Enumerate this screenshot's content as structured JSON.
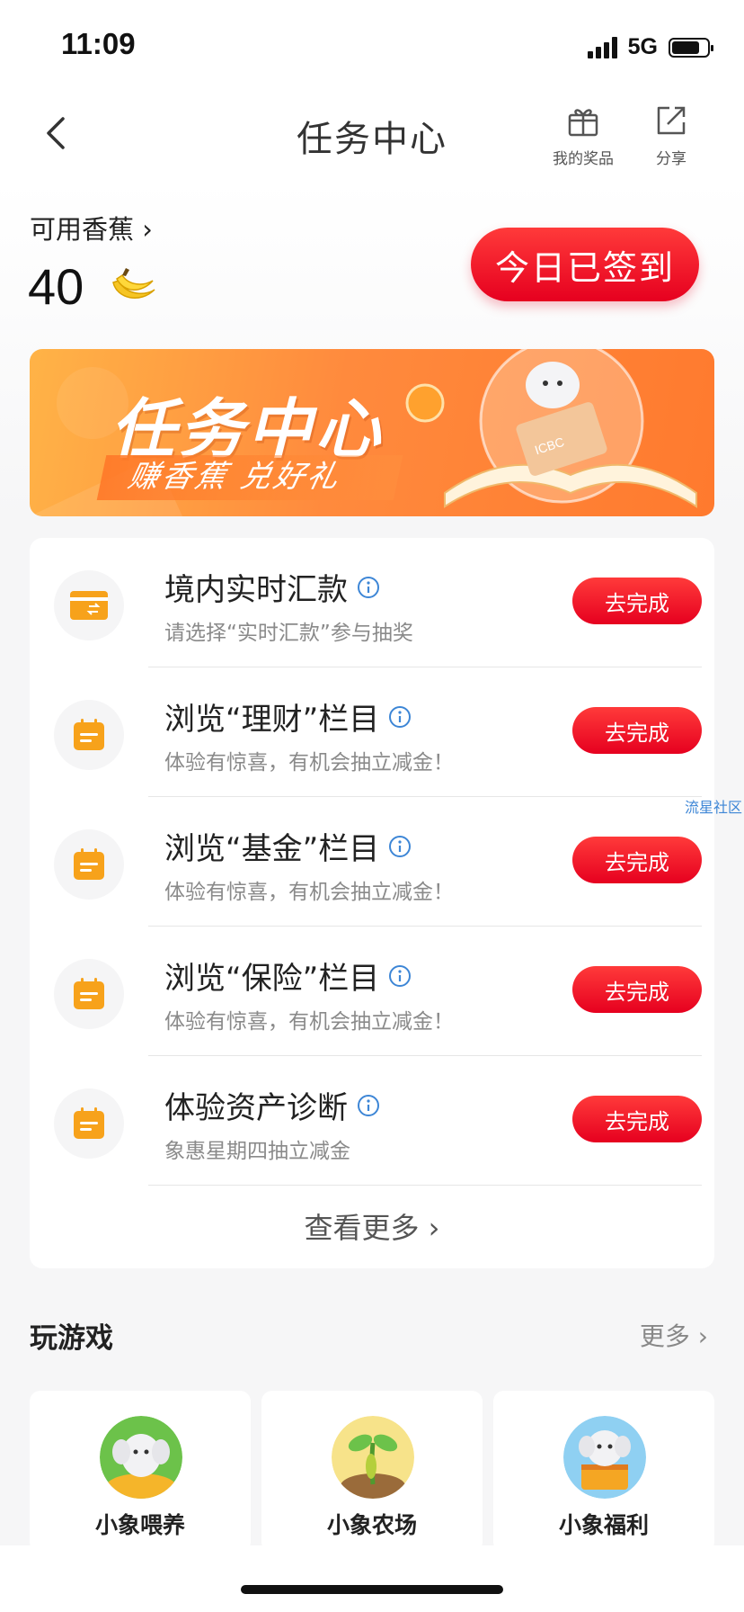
{
  "status_bar": {
    "time": "11:09",
    "network": "5G"
  },
  "nav": {
    "title": "任务中心",
    "gift_label": "我的奖品",
    "share_label": "分享"
  },
  "account": {
    "available_label": "可用香蕉 ›",
    "banana_count": "40",
    "signin_button": "今日已签到"
  },
  "banner": {
    "title": "任务中心",
    "subtitle": "赚香蕉 兑好礼",
    "brand": "ICBC"
  },
  "tasks": [
    {
      "title": "境内实时汇款",
      "subtitle": "请选择“实时汇款”参与抽奖",
      "button": "去完成",
      "icon": "card-transfer-icon"
    },
    {
      "title": "浏览“理财”栏目",
      "subtitle": "体验有惊喜，有机会抽立减金！",
      "button": "去完成",
      "icon": "calendar-icon"
    },
    {
      "title": "浏览“基金”栏目",
      "subtitle": "体验有惊喜，有机会抽立减金！",
      "button": "去完成",
      "icon": "calendar-icon"
    },
    {
      "title": "浏览“保险”栏目",
      "subtitle": "体验有惊喜，有机会抽立减金！",
      "button": "去完成",
      "icon": "calendar-icon"
    },
    {
      "title": "体验资产诊断",
      "subtitle": "象惠星期四抽立减金",
      "button": "去完成",
      "icon": "calendar-icon"
    }
  ],
  "see_more": "查看更多 ›",
  "watermark": "流星社区",
  "games": {
    "heading": "玩游戏",
    "more": "更多 ›",
    "items": [
      {
        "label": "小象喂养"
      },
      {
        "label": "小象农场"
      },
      {
        "label": "小象福利"
      }
    ]
  },
  "colors": {
    "accent_red": "#e6001f",
    "banner_orange": "#ff8a3d",
    "task_icon_orange": "#f7a21b"
  }
}
